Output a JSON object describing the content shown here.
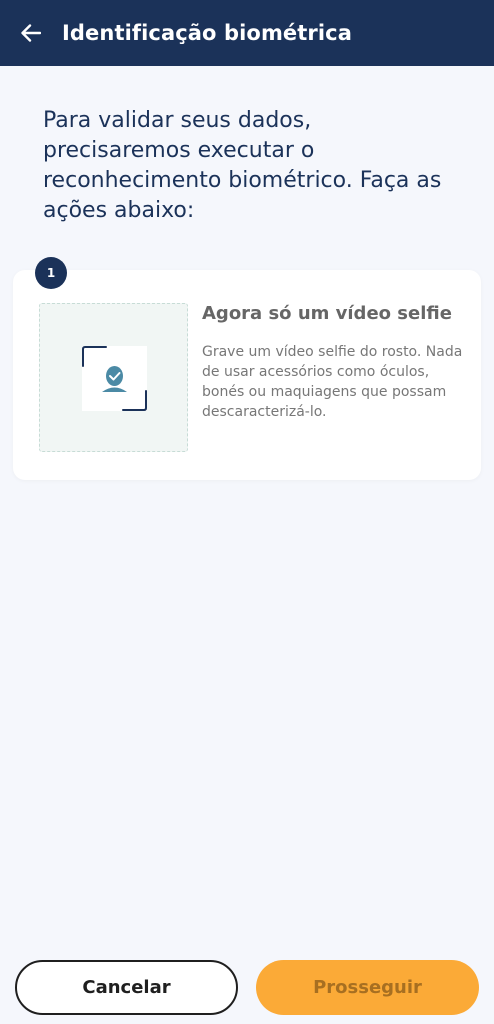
{
  "header": {
    "title": "Identificação biométrica",
    "background": "#1b3259",
    "back_icon": "arrow-left-icon"
  },
  "intro": {
    "text": "Para validar seus dados, precisaremos executar o reconhecimento biométrico. Faça as ações abaixo:"
  },
  "step": {
    "number": "1",
    "title": "Agora só um vídeo selfie",
    "description": "Grave um vídeo selfie do rosto. Nada de usar acessórios como óculos, bonés ou maquiagens que possam descaracterizá-lo.",
    "icon": "face-scan-icon"
  },
  "actions": {
    "cancel_label": "Cancelar",
    "proceed_label": "Prosseguir",
    "proceed_color": "#fbaa37"
  }
}
